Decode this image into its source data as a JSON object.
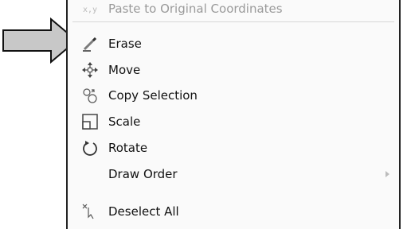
{
  "menu": {
    "items": [
      {
        "label": "Paste to Original Coordinates",
        "icon": "paste-coordinates-icon",
        "state": "disabled"
      },
      {
        "label": "Erase",
        "icon": "eraser-icon"
      },
      {
        "label": "Move",
        "icon": "move-icon"
      },
      {
        "label": "Copy Selection",
        "icon": "copy-selection-icon"
      },
      {
        "label": "Scale",
        "icon": "scale-icon"
      },
      {
        "label": "Rotate",
        "icon": "rotate-icon"
      },
      {
        "label": "Draw Order",
        "icon": "",
        "has_submenu": true
      },
      {
        "label": "Deselect All",
        "icon": "deselect-all-icon"
      }
    ]
  },
  "pointer": {
    "icon": "arrow-pointer-icon",
    "points_to": "Erase"
  }
}
